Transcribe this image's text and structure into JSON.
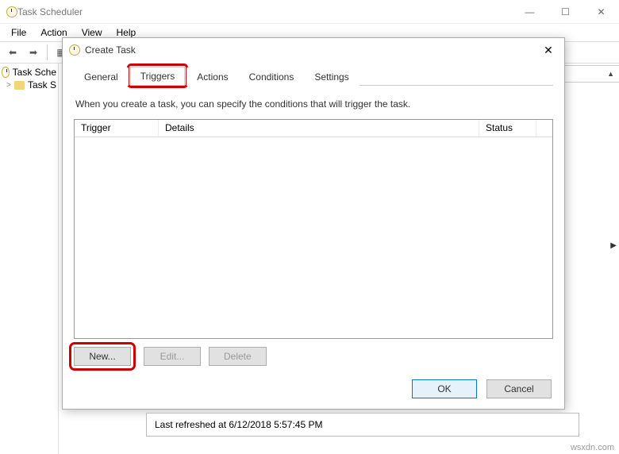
{
  "main": {
    "title": "Task Scheduler",
    "menu": {
      "file": "File",
      "action": "Action",
      "view": "View",
      "help": "Help"
    },
    "tree": {
      "root": "Task Sche",
      "child": "Task S"
    },
    "status": "Last refreshed at 6/12/2018 5:57:45 PM",
    "watermark": "wsxdn.com"
  },
  "dialog": {
    "title": "Create Task",
    "tabs": {
      "general": "General",
      "triggers": "Triggers",
      "actions": "Actions",
      "conditions": "Conditions",
      "settings": "Settings"
    },
    "instructions": "When you create a task, you can specify the conditions that will trigger the task.",
    "columns": {
      "trigger": "Trigger",
      "details": "Details",
      "status": "Status"
    },
    "buttons": {
      "new": "New...",
      "edit": "Edit...",
      "delete": "Delete",
      "ok": "OK",
      "cancel": "Cancel"
    }
  }
}
